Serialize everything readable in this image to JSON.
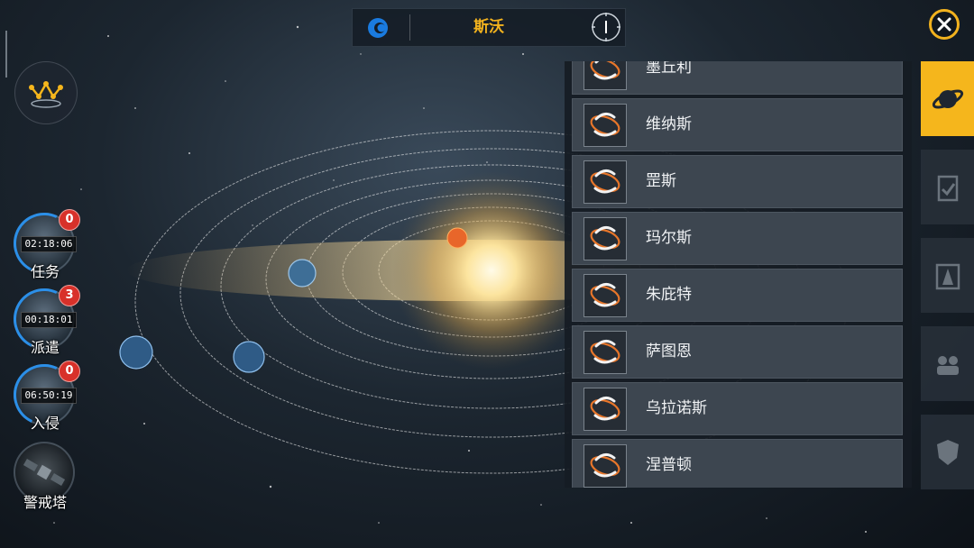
{
  "header": {
    "title": "斯沃",
    "logo_icon": "alliance-logo-icon",
    "compass_icon": "compass-icon"
  },
  "close_icon": "close-icon",
  "map_button_icon": "constellation-map-icon",
  "side_items": [
    {
      "label": "任务",
      "timer": "02:18:06",
      "badge": "0"
    },
    {
      "label": "派遣",
      "timer": "00:18:01",
      "badge": "3"
    },
    {
      "label": "入侵",
      "timer": "06:50:19",
      "badge": "0"
    },
    {
      "label": "警戒塔"
    }
  ],
  "planets": [
    "墨丘利",
    "维纳斯",
    "罡斯",
    "玛尔斯",
    "朱庇特",
    "萨图恩",
    "乌拉诺斯",
    "涅普顿"
  ],
  "right_tabs": [
    "planet-icon",
    "clipboard-check-icon",
    "landmark-icon",
    "fleet-icon",
    "shield-emblem-icon"
  ],
  "colors": {
    "accent": "#f5b61c",
    "badge": "#d8312a",
    "timer_ring": "#2b8fe8",
    "planet_orbit_icon": "#e8762a"
  }
}
